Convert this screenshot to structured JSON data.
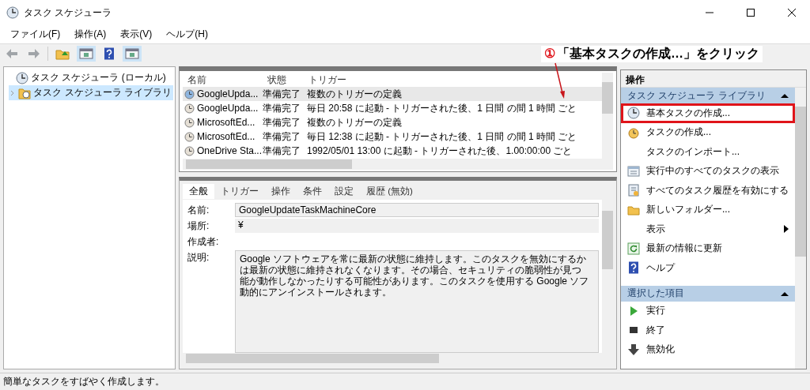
{
  "window": {
    "title": "タスク スケジューラ"
  },
  "menu": [
    "ファイル(F)",
    "操作(A)",
    "表示(V)",
    "ヘルプ(H)"
  ],
  "toolbar": [
    {
      "kind": "back"
    },
    {
      "kind": "forward"
    },
    {
      "kind": "folder"
    },
    {
      "kind": "pane"
    },
    {
      "kind": "help"
    },
    {
      "kind": "pane"
    }
  ],
  "annotation": {
    "number": "①",
    "text": "「基本タスクの作成…」をクリック"
  },
  "tree": [
    {
      "label": "タスク スケジューラ (ローカル)",
      "selected": false,
      "expanded": true,
      "children": [
        {
          "label": "タスク スケジューラ ライブラリ",
          "selected": true,
          "expanded": false
        }
      ]
    }
  ],
  "task_list": {
    "columns": [
      "名前",
      "状態",
      "トリガー"
    ],
    "rows": [
      {
        "name": "GoogleUpda...",
        "status": "準備完了",
        "trigger": "複数のトリガーの定義",
        "selected": true
      },
      {
        "name": "GoogleUpda...",
        "status": "準備完了",
        "trigger": "毎日 20:58 に起動 - トリガーされた後、1 日間 の間 1 時間 ごと",
        "selected": false
      },
      {
        "name": "MicrosoftEd...",
        "status": "準備完了",
        "trigger": "複数のトリガーの定義",
        "selected": false
      },
      {
        "name": "MicrosoftEd...",
        "status": "準備完了",
        "trigger": "毎日 12:38 に起動 - トリガーされた後、1 日間 の間 1 時間 ごと",
        "selected": false
      },
      {
        "name": "OneDrive Sta...",
        "status": "準備完了",
        "trigger": "1992/05/01 13:00 に起動 - トリガーされた後、1.00:00:00 ごと",
        "selected": false
      }
    ]
  },
  "detail": {
    "tabs": [
      {
        "label": "全般",
        "selected": true
      },
      {
        "label": "トリガー",
        "selected": false
      },
      {
        "label": "操作",
        "selected": false
      },
      {
        "label": "条件",
        "selected": false
      },
      {
        "label": "設定",
        "selected": false
      },
      {
        "label": "履歴 (無効)",
        "selected": false
      }
    ],
    "fields": [
      {
        "label": "名前:",
        "kind": "input",
        "value": "GoogleUpdateTaskMachineCore"
      },
      {
        "label": "場所:",
        "kind": "text",
        "value": "¥"
      },
      {
        "label": "作成者:",
        "kind": "text"
      },
      {
        "label": "説明:",
        "kind": "textarea",
        "lines": [
          "Google ソフトウェアを常に最新の状態に維持します。このタスクを無効にするか",
          "は最新の状態に維持されなくなります。その場合、セキュリティの脆弱性が見つ",
          "能が動作しなかったりする可能性があります。このタスクを使用する Google ソフ",
          "動的にアンインストールされます。"
        ]
      }
    ]
  },
  "actions": {
    "title": "操作",
    "sections": [
      {
        "title": "タスク スケジューラ ライブラリ",
        "expanded": true,
        "items": [
          {
            "label": "基本タスクの作成...",
            "kind": "clock",
            "highlighted": true
          },
          {
            "label": "タスクの作成...",
            "kind": "task",
            "highlighted": false
          },
          {
            "label": "タスクのインポート...",
            "kind": "none",
            "highlighted": false
          },
          {
            "label": "実行中のすべてのタスクの表示",
            "kind": "list",
            "highlighted": false
          },
          {
            "label": "すべてのタスク履歴を有効にする",
            "kind": "history",
            "highlighted": false
          },
          {
            "label": "新しいフォルダー...",
            "kind": "folder",
            "highlighted": false
          },
          {
            "label": "表示",
            "kind": "submenu",
            "highlighted": false
          },
          {
            "label": "最新の情報に更新",
            "kind": "refresh",
            "highlighted": false
          },
          {
            "label": "ヘルプ",
            "kind": "help",
            "highlighted": false
          }
        ]
      },
      {
        "title": "選択した項目",
        "expanded": true,
        "items": [
          {
            "label": "実行",
            "kind": "play",
            "highlighted": false
          },
          {
            "label": "終了",
            "kind": "stop",
            "highlighted": false
          },
          {
            "label": "無効化",
            "kind": "disable",
            "highlighted": false
          }
        ]
      }
    ]
  },
  "status_bar": "簡単なタスクをすばやく作成します。"
}
